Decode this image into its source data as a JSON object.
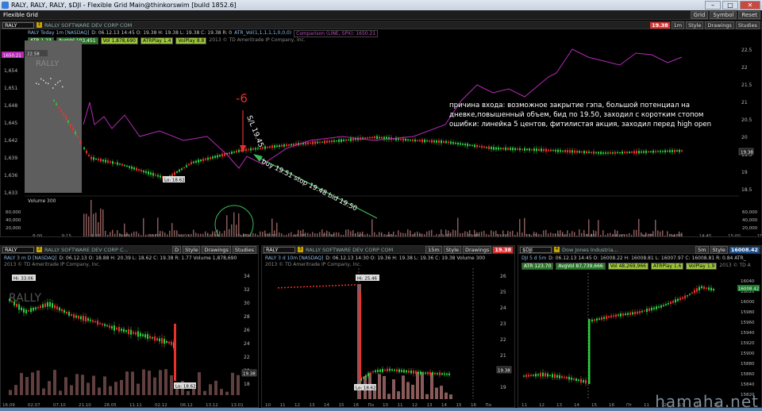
{
  "window": {
    "title": "RALY, RALY, RALY, $DJI - Flexible Grid Main@thinkorswim [build 1852.6]",
    "grid_label": "Flexible Grid",
    "buttons": [
      "Grid",
      "Symbol",
      "Reset"
    ]
  },
  "main_chart": {
    "symbol": "RALY",
    "header_label": "RALY Today 1m [NASDAQ]",
    "company": "RALLY SOFTWARE DEV CORP COM",
    "price": "19.38",
    "timeframe": "1m",
    "style_label": "Style",
    "drawings_label": "Drawings",
    "studies_label": "Studies",
    "info": "D: 06.12.13 14:45  O: 19.38  H: 19.38  L: 19.38  C: 19.38  R: 0",
    "atr_vol_study": "ATR_Vol(1,1,1,1,1,0,0,0)",
    "comparison": "Comparison (LINE, SPX): 1650.21",
    "chips": [
      "ATR 1.23",
      "AvgVol 193,451",
      "Vol 1,878,690",
      "ATRPlay 1.4",
      "VolPlay 8.8"
    ],
    "copyright": "2013 © TD Ameritrade IP Company, Inc.",
    "price_labels": [
      "22.5",
      "22",
      "21.5",
      "21",
      "20.5",
      "20",
      "19.5",
      "19",
      "18.5"
    ],
    "left_price_labels": [
      "1,654",
      "1,651",
      "1,648",
      "1,645",
      "1,642",
      "1,639",
      "1,636",
      "1,633"
    ],
    "current_price_badge": "19.38",
    "spx_badge": "1650.21",
    "low_label": "Lo: 18.62",
    "premarket_label": "22.58",
    "volume_label": "Volume",
    "volume_value": "300",
    "volume_ticks": [
      "60,000",
      "40,000",
      "20,000"
    ],
    "time_labels": [
      "8:00",
      "9:15",
      "9:30",
      "9:45",
      "10:00",
      "10:15",
      "10:30",
      "10:45",
      "11:00",
      "11:15",
      "11:30",
      "11:45",
      "12:00",
      "12:15",
      "12:30",
      "12:45",
      "13:00",
      "13:15",
      "13:30",
      "13:45",
      "14:00",
      "14:15",
      "14:30",
      "14:45",
      "15:00",
      "15:15"
    ]
  },
  "annotations": {
    "minus_six": "-6",
    "stop_label": "S/L 19.45",
    "trade": "buy 19.51 stop 19.48 bid 19.50",
    "note": "причина входа: возможное закрытие гэпа, большой потенциал на дневке,повышенный объем, бид по 19.50, заходил с коротким стопом ошибки: линейка 5 центов, фитилистая акция, заходил перед high open"
  },
  "panel_daily": {
    "symbol": "RALY",
    "header_label": "RALY 3 m D [NASDAQ]",
    "company": "RALLY SOFTWARE DEV CORP C...",
    "timeframe": "D",
    "price": "19.38",
    "info": "D: 06.12.13  O: 18.88  H: 20.39  L: 18.62  C: 19.38  R: 1.77  Volume 1,878,690",
    "copyright": "2013 © TD Ameritrade IP Company, Inc.",
    "hi_label": "Hi: 33.06",
    "lo_label": "Lo: 18.62",
    "price_labels": [
      "34",
      "32",
      "30",
      "28",
      "26",
      "24",
      "22",
      "20",
      "18"
    ],
    "time_labels": [
      "16.09",
      "02.07",
      "07.10",
      "21.10",
      "28.05",
      "11.11",
      "02.12",
      "06.12",
      "13.12",
      "13.01"
    ],
    "current_badge": "19.38"
  },
  "panel_10m": {
    "symbol": "RALY",
    "header_label": "RALY 3 d 10m [NASDAQ]",
    "company": "RALLY SOFTWARE DEV CORP COM",
    "timeframe": "15m",
    "price": "19.38",
    "info": "D: 06.12.13 14:30  O: 19.36  H: 19.38  L: 19.36  C: 19.38  Volume 300",
    "copyright": "2013 © TD Ameritrade IP Company, Inc.",
    "hi_label": "Hi: 25.46",
    "lo_label": "Lo: 18.62",
    "price_labels": [
      "26",
      "25",
      "24",
      "23",
      "22",
      "21",
      "20",
      "19"
    ],
    "time_labels": [
      "10",
      "11",
      "12",
      "13",
      "14",
      "15",
      "16",
      "Пн",
      "10",
      "11",
      "12",
      "13",
      "14",
      "15",
      "16",
      "Пн"
    ],
    "current_badge": "19.38"
  },
  "panel_dji": {
    "symbol": "$DJI",
    "header_label": "DJI 5 d 5m",
    "company": "Dow Jones Industria...",
    "timeframe": "5m",
    "price": "16008.42",
    "info": "D: 06.12.13 14:45  O: 16008.22  H: 16008.81  L: 16007.97  C: 16008.81  R: 0.84  ATR_",
    "chips": [
      "ATR 123.70",
      "AvgVol 87,739,666",
      "Vol 48,269,966",
      "ATRPlay 1.6",
      "VolPlay 1.9"
    ],
    "copyright": "2013 © TD A",
    "price_labels": [
      "16040",
      "16020",
      "16000",
      "15980",
      "15960",
      "15940",
      "15920",
      "15900",
      "15880",
      "15860",
      "15840",
      "15820"
    ],
    "time_labels": [
      "11",
      "12",
      "13",
      "14",
      "15",
      "16",
      "Пт",
      "11",
      "12",
      "13",
      "14",
      "15"
    ],
    "current_badge": "16008.42"
  },
  "watermark": "hamaha.net",
  "colors": {
    "up": "#2ecc40",
    "down": "#e8322e",
    "spx_line": "#b52bb5",
    "volume": "#8a5a5a",
    "annotation_red": "#e03030",
    "annotation_green": "#3dbb55"
  }
}
